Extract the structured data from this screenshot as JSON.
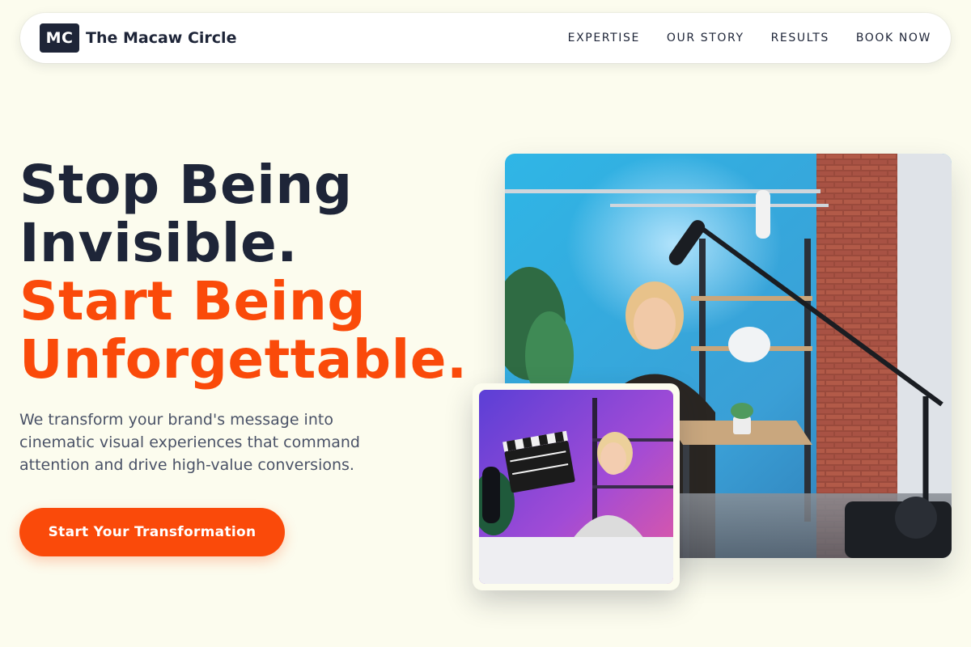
{
  "brand": {
    "logo_text": "MC",
    "name": "The Macaw Circle"
  },
  "nav": {
    "items": [
      {
        "label": "EXPERTISE"
      },
      {
        "label": "OUR STORY"
      },
      {
        "label": "RESULTS"
      },
      {
        "label": "BOOK NOW"
      }
    ]
  },
  "hero": {
    "headline_line1": "Stop Being",
    "headline_line2": "Invisible.",
    "headline_line3": "Start Being",
    "headline_line4": "Unforgettable.",
    "subtext": "We transform your brand's message into cinematic visual experiences that command attention and drive high-value conversions.",
    "cta_label": "Start Your Transformation"
  },
  "colors": {
    "background": "#fcfcee",
    "navy": "#1e2538",
    "accent": "#fa4a0a"
  }
}
